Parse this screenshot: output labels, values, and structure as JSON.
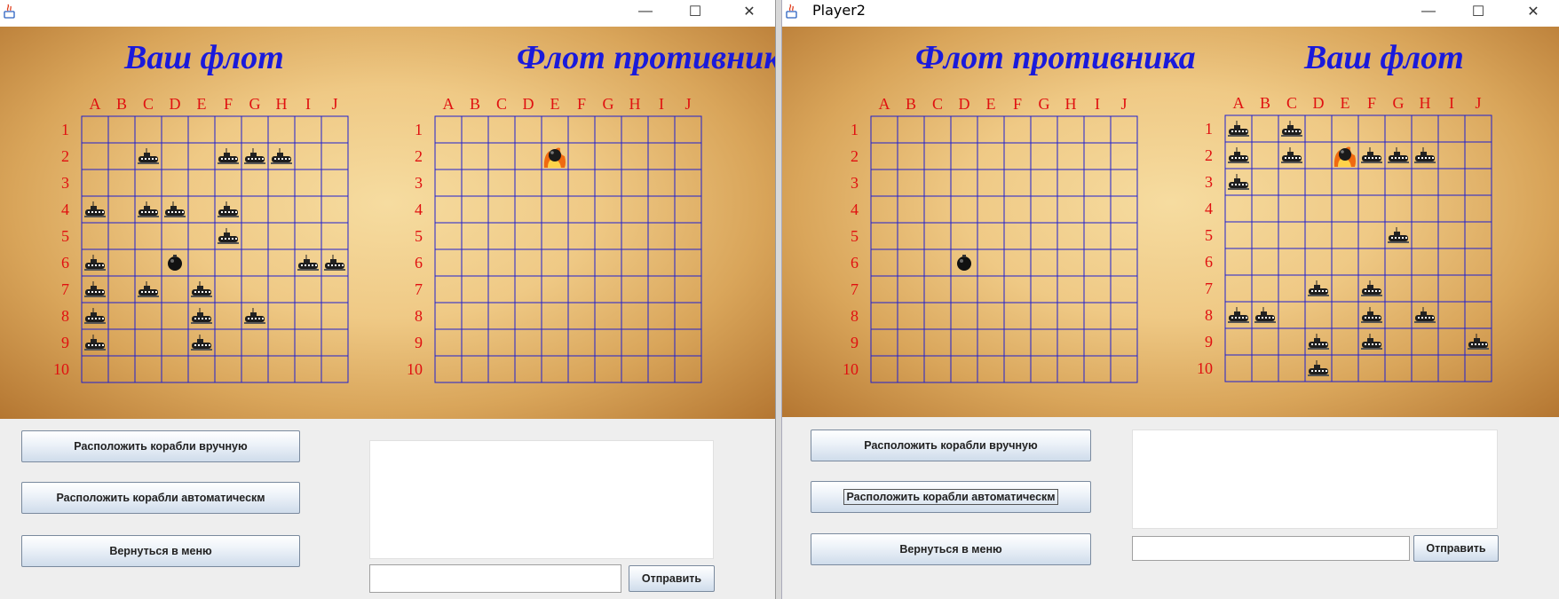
{
  "columns": [
    "A",
    "B",
    "C",
    "D",
    "E",
    "F",
    "G",
    "H",
    "I",
    "J"
  ],
  "rows": [
    "1",
    "2",
    "3",
    "4",
    "5",
    "6",
    "7",
    "8",
    "9",
    "10"
  ],
  "icons": {
    "ship": "submarine-icon",
    "bomb": "bomb-icon",
    "hit": "fire-explosion-icon"
  },
  "windows": [
    {
      "title": "",
      "controls": {
        "minimize": "—",
        "maximize": "☐",
        "close": "✕"
      },
      "left_board_title": "Ваш флот",
      "right_board_title": "Флот противника",
      "left_board": {
        "ships": [
          "C2",
          "F2",
          "G2",
          "H2",
          "A4",
          "C4",
          "D4",
          "F4",
          "F5",
          "A6",
          "I6",
          "J6",
          "A7",
          "C7",
          "E7",
          "A8",
          "E8",
          "G8",
          "A9",
          "E9"
        ],
        "bombs": [
          "D6"
        ],
        "hits": []
      },
      "right_board": {
        "ships": [],
        "bombs": [],
        "hits": [
          "E2"
        ]
      },
      "buttons": {
        "place_manual": "Расположить корабли вручную",
        "place_auto": "Расположить корабли автоматическм",
        "back_menu": "Вернуться в меню",
        "send": "Отправить"
      },
      "chat_log": "",
      "chat_input": ""
    },
    {
      "title": "Player2",
      "controls": {
        "minimize": "—",
        "maximize": "☐",
        "close": "✕"
      },
      "left_board_title": "Флот противника",
      "right_board_title": "Ваш флот",
      "left_board": {
        "ships": [],
        "bombs": [
          "D6"
        ],
        "hits": []
      },
      "right_board": {
        "ships": [
          "A1",
          "C1",
          "A2",
          "C2",
          "F2",
          "G2",
          "H2",
          "A3",
          "G5",
          "D7",
          "F7",
          "A8",
          "B8",
          "F8",
          "H8",
          "D9",
          "F9",
          "J9",
          "D10"
        ],
        "bombs": [],
        "hits": [
          "E2"
        ]
      },
      "buttons": {
        "place_manual": "Расположить корабли вручную",
        "place_auto": "Расположить корабли автоматическм",
        "back_menu": "Вернуться в меню",
        "send": "Отправить"
      },
      "chat_log": "",
      "chat_input": ""
    }
  ]
}
